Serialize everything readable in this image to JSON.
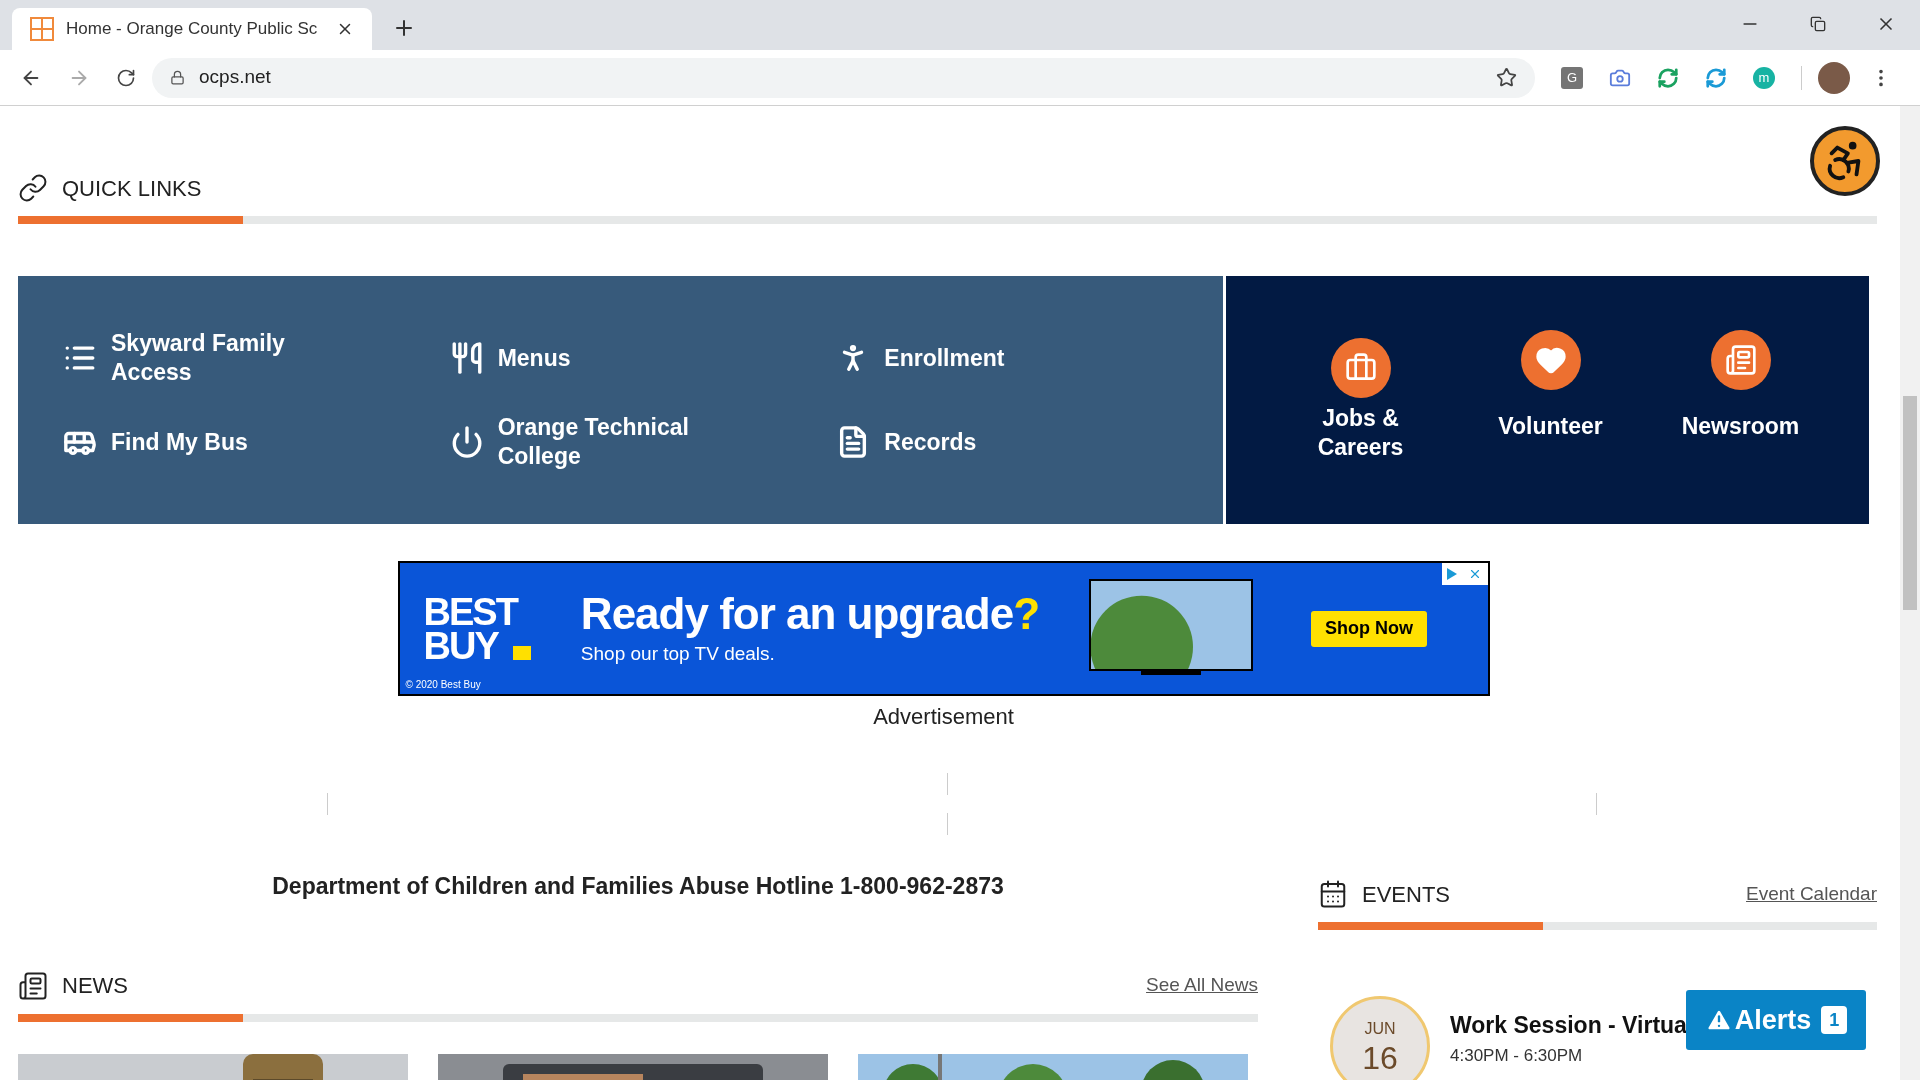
{
  "browser": {
    "tab_title": "Home - Orange County Public Sc",
    "address": "ocps.net",
    "extensions": [
      {
        "kind": "letter",
        "text": "G",
        "color": "#757575"
      },
      {
        "kind": "camera",
        "color": "#5b7ddb"
      },
      {
        "kind": "sync",
        "color": "#1aa260"
      },
      {
        "kind": "sync",
        "color": "#1a9ad6"
      },
      {
        "kind": "letter",
        "text": "m",
        "color": "#17b3a3"
      }
    ]
  },
  "quick_links": {
    "title": "QUICK LINKS",
    "links": [
      {
        "label": "Skyward Family Access"
      },
      {
        "label": "Menus"
      },
      {
        "label": "Enrollment"
      },
      {
        "label": "Find My Bus"
      },
      {
        "label": "Orange Technical College"
      },
      {
        "label": "Records"
      }
    ],
    "featured": [
      {
        "label": "Jobs & Careers"
      },
      {
        "label": "Volunteer"
      },
      {
        "label": "Newsroom"
      }
    ]
  },
  "ad": {
    "logo_lines": [
      "BEST",
      "BUY"
    ],
    "headline": "Ready for an upgrade",
    "headline_mark": "?",
    "subline": "Shop our top TV deals.",
    "button": "Shop Now",
    "copyright": "© 2020 Best Buy",
    "caption": "Advertisement"
  },
  "hotline": "Department of Children and Families Abuse Hotline 1-800-962-2873",
  "news": {
    "title": "NEWS",
    "link": "See All News"
  },
  "events": {
    "title": "EVENTS",
    "link": "Event Calendar",
    "items": [
      {
        "month": "JUN",
        "day": "16",
        "title": "Work Session - Virtua",
        "time": "4:30PM - 6:30PM"
      }
    ]
  },
  "alerts": {
    "label": "Alerts",
    "count": "1"
  }
}
